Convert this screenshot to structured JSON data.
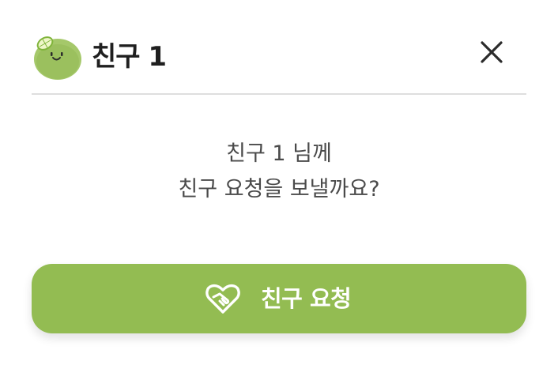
{
  "dialog": {
    "title": "친구 1",
    "message_line1": "친구 1 님께",
    "message_line2": "친구 요청을 보낼까요?",
    "request_button_label": "친구 요청",
    "close_label": "close"
  },
  "icons": {
    "avatar": "lime-character-icon",
    "close": "close-icon",
    "request": "heart-handshake-icon"
  },
  "colors": {
    "accent": "#93bc52",
    "title_text": "#1f1f1f",
    "message_text": "#4a4a4a",
    "divider": "#dedede",
    "button_text": "#ffffff"
  }
}
